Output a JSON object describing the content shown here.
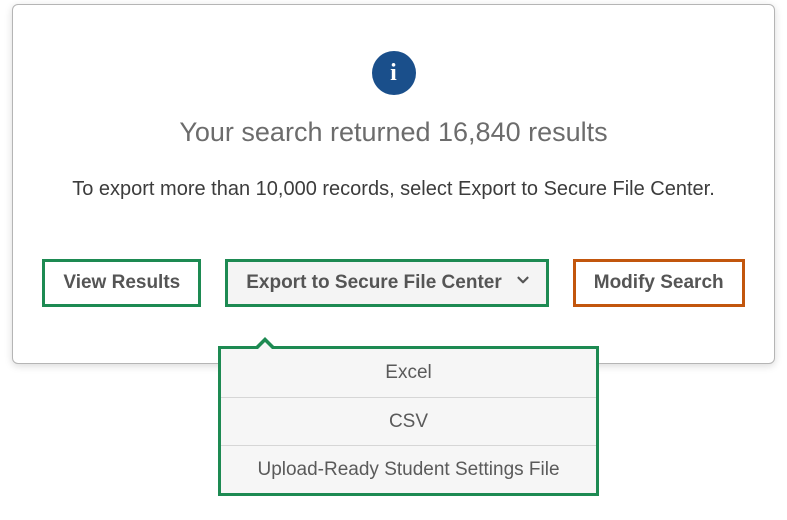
{
  "icon": {
    "glyph": "i"
  },
  "headline": "Your search returned 16,840 results",
  "subline": "To export more than 10,000 records, select Export to Secure File Center.",
  "buttons": {
    "view": "View Results",
    "export": "Export to Secure File Center",
    "modify": "Modify Search"
  },
  "exportMenu": {
    "items": [
      "Excel",
      "CSV",
      "Upload-Ready Student Settings File"
    ]
  }
}
